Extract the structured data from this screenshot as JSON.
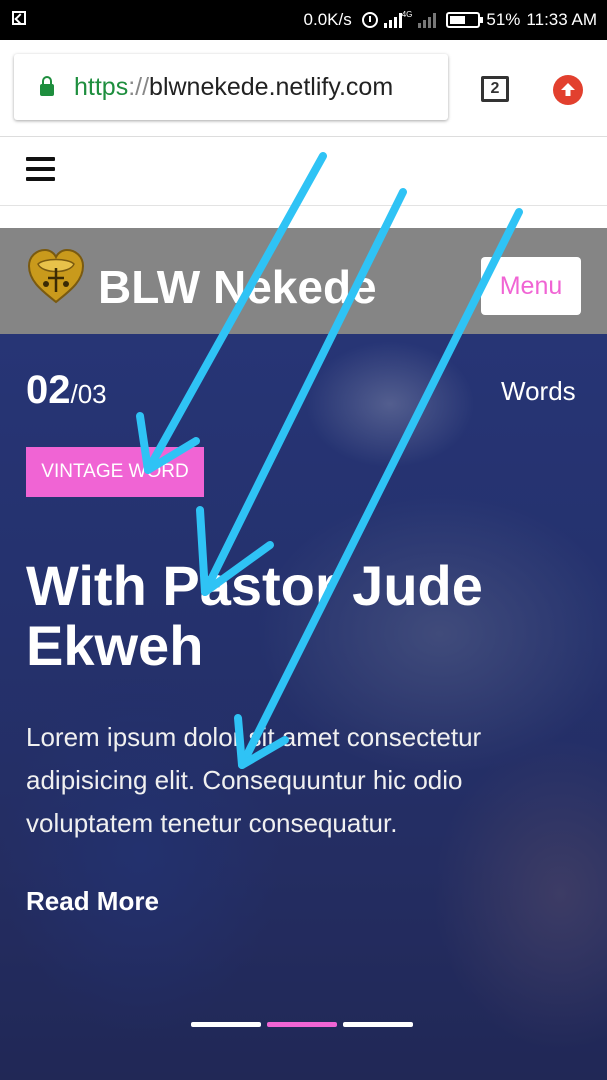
{
  "status_bar": {
    "net_speed": "0.0K/s",
    "network_type": "4G",
    "battery": "51%",
    "time": "11:33 AM"
  },
  "browser": {
    "url_scheme": "https",
    "url_separator": "://",
    "url_host": "blwnekede.netlify.com",
    "tab_count": "2"
  },
  "site": {
    "brand": "BLW Nekede",
    "menu_label": "Menu"
  },
  "slide": {
    "current": "02",
    "total": "/03",
    "category": "Words",
    "tag": "VINTAGE WORD",
    "title": "With Pastor Jude Ekweh",
    "text": "Lorem ipsum dolor sit amet consectetur adipisicing elit. Consequuntur hic odio voluptatem tenetur consequatur.",
    "read_more": "Read More",
    "indicator_count": 3,
    "active_indicator": 2
  },
  "colors": {
    "accent_pink": "#f064d4",
    "header_gray": "#858585",
    "arrow_blue": "#2fc3f5",
    "secure_green": "#1e8e3e",
    "upload_red": "#e2402e"
  },
  "icons": [
    "screenshot-icon",
    "alarm-icon",
    "signal-icon",
    "battery-icon",
    "lock-icon",
    "tabs-icon",
    "upload-icon",
    "hamburger-icon",
    "logo-icon",
    "arrow-annotation"
  ]
}
